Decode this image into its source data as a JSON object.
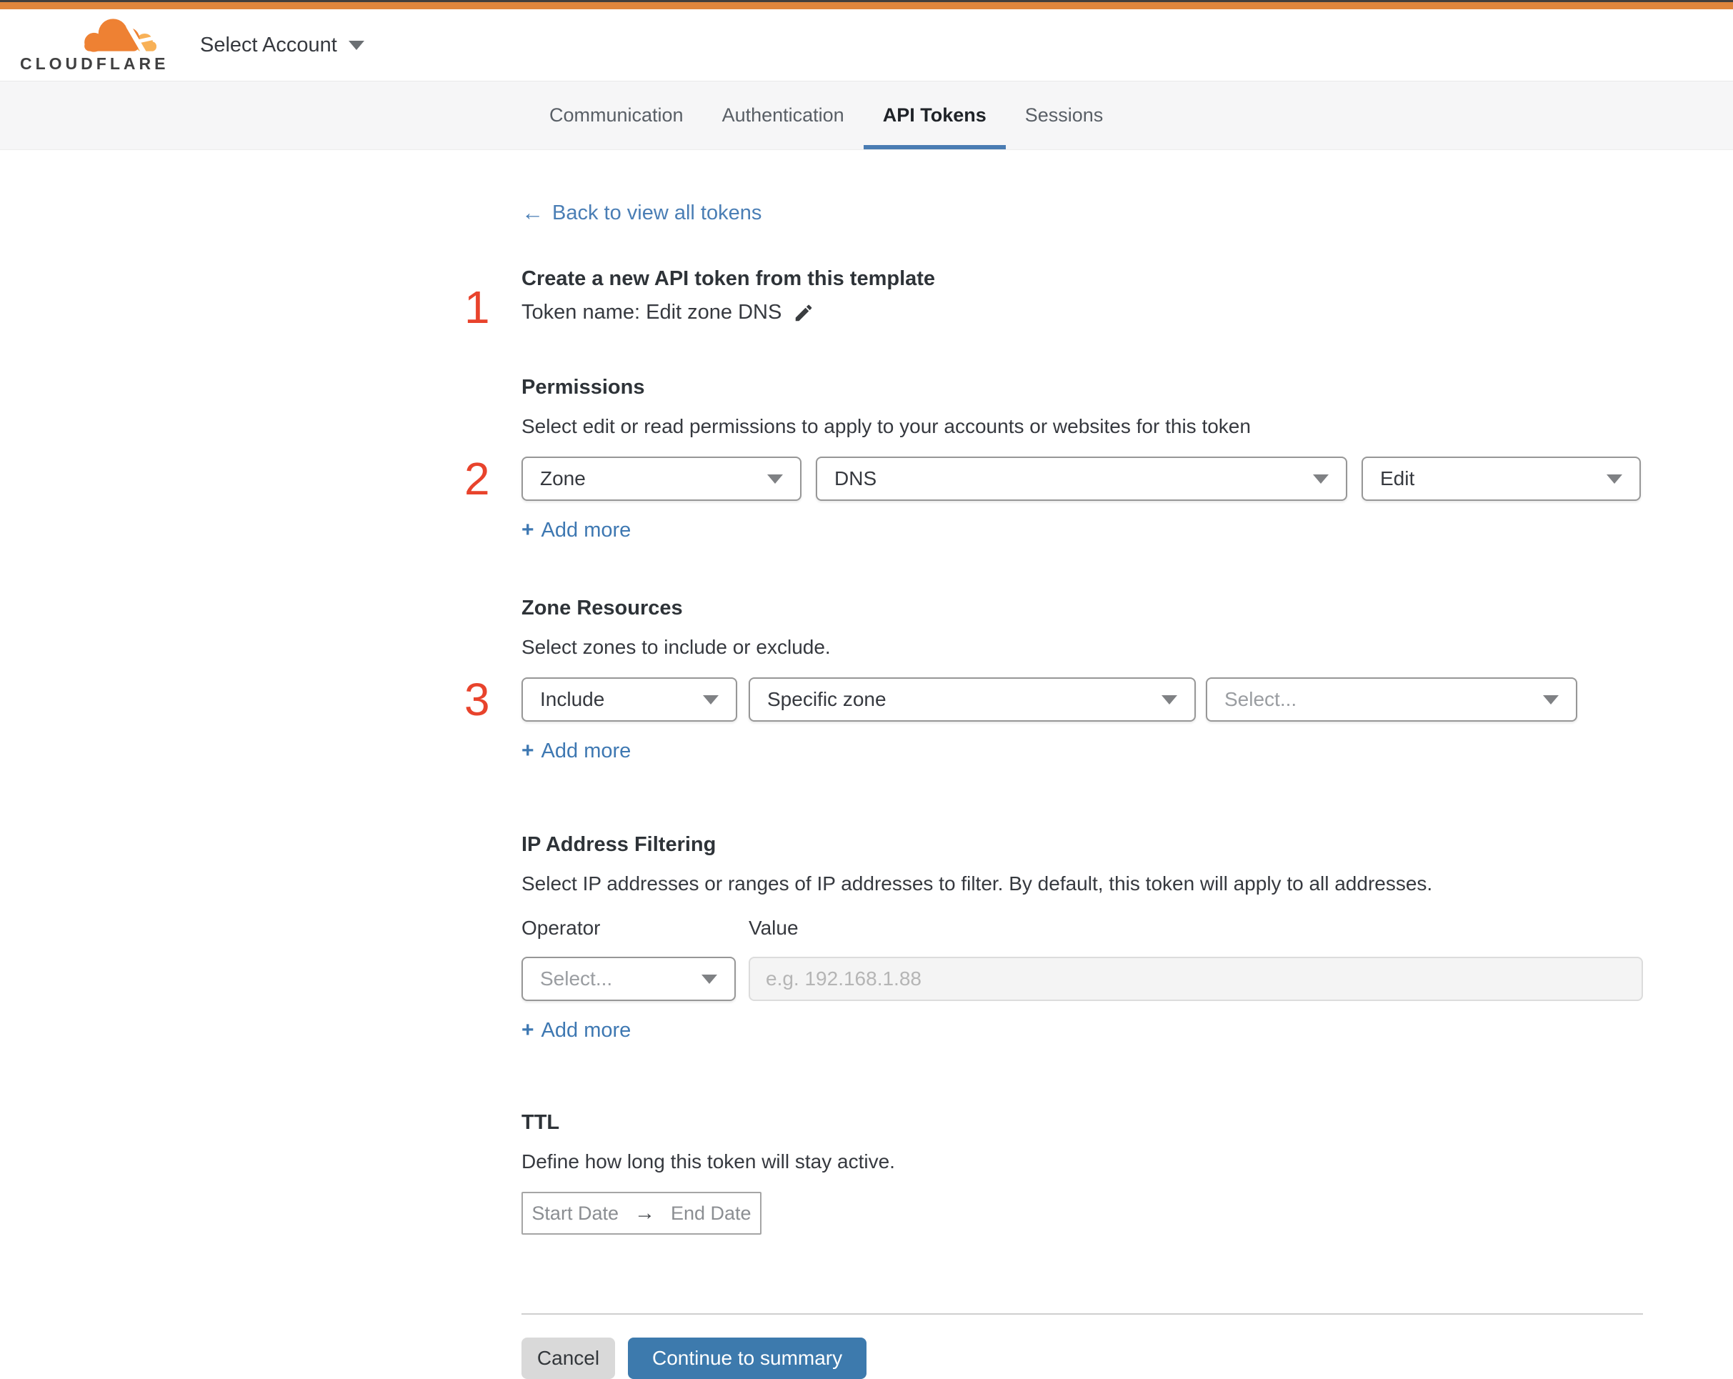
{
  "header": {
    "brand": "CLOUDFLARE",
    "account_selector": "Select Account"
  },
  "tabs": [
    {
      "label": "Communication",
      "active": false
    },
    {
      "label": "Authentication",
      "active": false
    },
    {
      "label": "API Tokens",
      "active": true
    },
    {
      "label": "Sessions",
      "active": false
    }
  ],
  "back_link": {
    "label": "Back to view all tokens"
  },
  "token": {
    "step": "1",
    "heading": "Create a new API token from this template",
    "name_line": "Token name: Edit zone DNS"
  },
  "permissions": {
    "step": "2",
    "heading": "Permissions",
    "description": "Select edit or read permissions to apply to your accounts or websites for this token",
    "scope_value": "Zone",
    "category_value": "DNS",
    "level_value": "Edit",
    "add_more": "Add more"
  },
  "zone_resources": {
    "step": "3",
    "heading": "Zone Resources",
    "description": "Select zones to include or exclude.",
    "operator_value": "Include",
    "type_value": "Specific zone",
    "zone_placeholder": "Select...",
    "add_more": "Add more"
  },
  "ip_filtering": {
    "heading": "IP Address Filtering",
    "description": "Select IP addresses or ranges of IP addresses to filter. By default, this token will apply to all addresses.",
    "operator_label": "Operator",
    "value_label": "Value",
    "operator_placeholder": "Select...",
    "value_placeholder": "e.g. 192.168.1.88",
    "add_more": "Add more"
  },
  "ttl": {
    "heading": "TTL",
    "description": "Define how long this token will stay active.",
    "start_label": "Start Date",
    "end_label": "End Date"
  },
  "footer": {
    "cancel_label": "Cancel",
    "continue_label": "Continue to summary"
  },
  "icons": {
    "back_arrow": "←",
    "range_arrow": "→",
    "plus": "+"
  },
  "colors": {
    "top_bar_orange": "#e0863c",
    "logo_orange": "#ee8133",
    "logo_light_orange": "#f8b157",
    "step_red": "#e8432c",
    "link_blue": "#4a7eb5",
    "tab_underline_blue": "#4a7cb3",
    "continue_button_blue": "#3d7aad",
    "cancel_gray": "#d9d9d9"
  }
}
